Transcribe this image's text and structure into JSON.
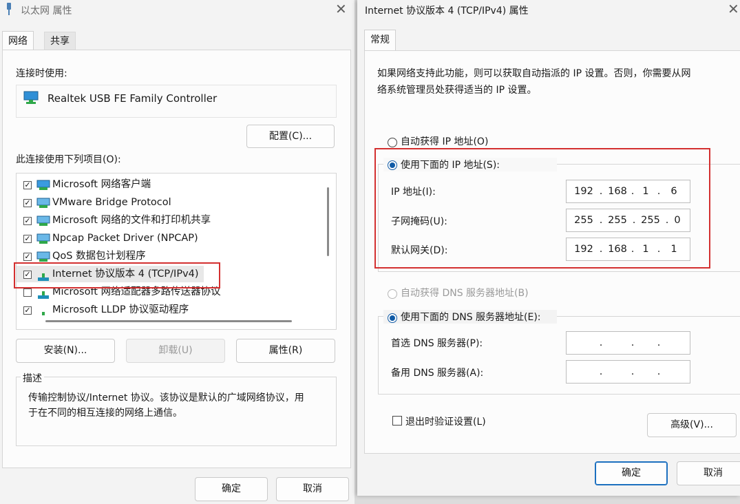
{
  "left": {
    "title": "以太网 属性",
    "tabs": [
      "网络",
      "共享"
    ],
    "connect_using_label": "连接时使用:",
    "adapter_name": "Realtek USB FE Family Controller",
    "configure_button": "配置(C)...",
    "items_label": "此连接使用下列项目(O):",
    "items": [
      {
        "label": "Microsoft 网络客户端",
        "checked": true
      },
      {
        "label": "VMware Bridge Protocol",
        "checked": true
      },
      {
        "label": "Microsoft 网络的文件和打印机共享",
        "checked": true
      },
      {
        "label": "Npcap Packet Driver (NPCAP)",
        "checked": true
      },
      {
        "label": "QoS 数据包计划程序",
        "checked": true
      },
      {
        "label": "Internet 协议版本 4 (TCP/IPv4)",
        "checked": true
      },
      {
        "label": "Microsoft 网络适配器多路传送器协议",
        "checked": false
      },
      {
        "label": "Microsoft LLDP 协议驱动程序",
        "checked": true
      }
    ],
    "install_button": "安装(N)...",
    "uninstall_button": "卸载(U)",
    "properties_button": "属性(R)",
    "description_label": "描述",
    "description_text_line1": "传输控制协议/Internet 协议。该协议是默认的广域网络协议，用",
    "description_text_line2": "于在不同的相互连接的网络上通信。",
    "ok_button": "确定",
    "cancel_button": "取消"
  },
  "right": {
    "title": "Internet 协议版本 4 (TCP/IPv4) 属性",
    "tab": "常规",
    "intro_line1": "如果网络支持此功能，则可以获取自动指派的 IP 设置。否则，你需要从网",
    "intro_line2": "络系统管理员处获得适当的 IP 设置。",
    "auto_ip_label": "自动获得 IP 地址(O)",
    "manual_ip_label": "使用下面的 IP 地址(S):",
    "ip_label": "IP 地址(I):",
    "ip": [
      "192",
      "168",
      "1",
      "6"
    ],
    "subnet_label": "子网掩码(U):",
    "subnet": [
      "255",
      "255",
      "255",
      "0"
    ],
    "gateway_label": "默认网关(D):",
    "gateway": [
      "192",
      "168",
      "1",
      "1"
    ],
    "auto_dns_label": "自动获得 DNS 服务器地址(B)",
    "manual_dns_label": "使用下面的 DNS 服务器地址(E):",
    "preferred_dns_label": "首选 DNS 服务器(P):",
    "alternate_dns_label": "备用 DNS 服务器(A):",
    "validate_label": "退出时验证设置(L)",
    "advanced_button": "高级(V)...",
    "ok_button": "确定",
    "cancel_button": "取消"
  },
  "colors": {
    "highlight_red": "#d32f2f",
    "accent_blue": "#0f5aa6"
  }
}
